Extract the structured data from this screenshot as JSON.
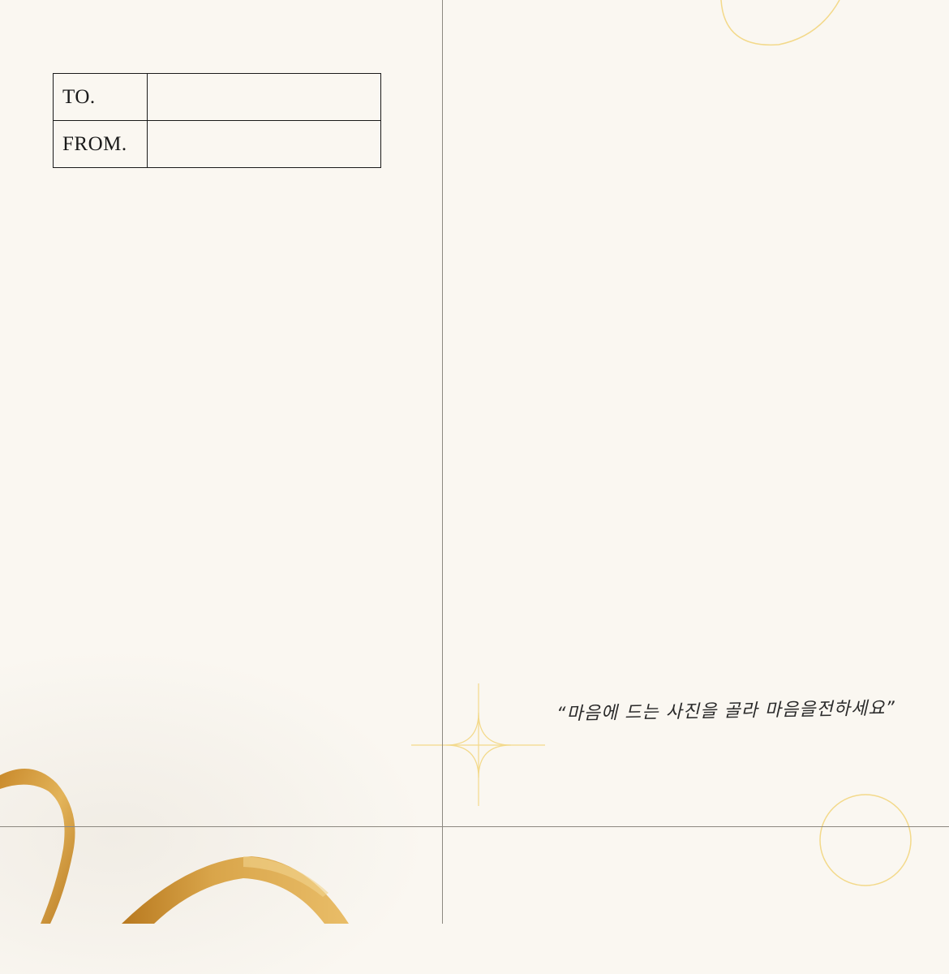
{
  "recipient": {
    "to_label": "TO.",
    "to_value": "",
    "from_label": "FROM.",
    "from_value": ""
  },
  "quote": {
    "text": "“마음에 드는 사진을 골라 마음을전하세요”"
  },
  "colors": {
    "paper": "#faf7f1",
    "fold_line": "#8c8880",
    "gold_line": "#f3d98a",
    "ribbon": "#d39a3a",
    "ink": "#1a1a1a"
  },
  "decorations": {
    "icons": [
      "sparkle-star-icon",
      "gold-circle-outline",
      "gold-arc-outline",
      "gold-ribbon"
    ]
  }
}
